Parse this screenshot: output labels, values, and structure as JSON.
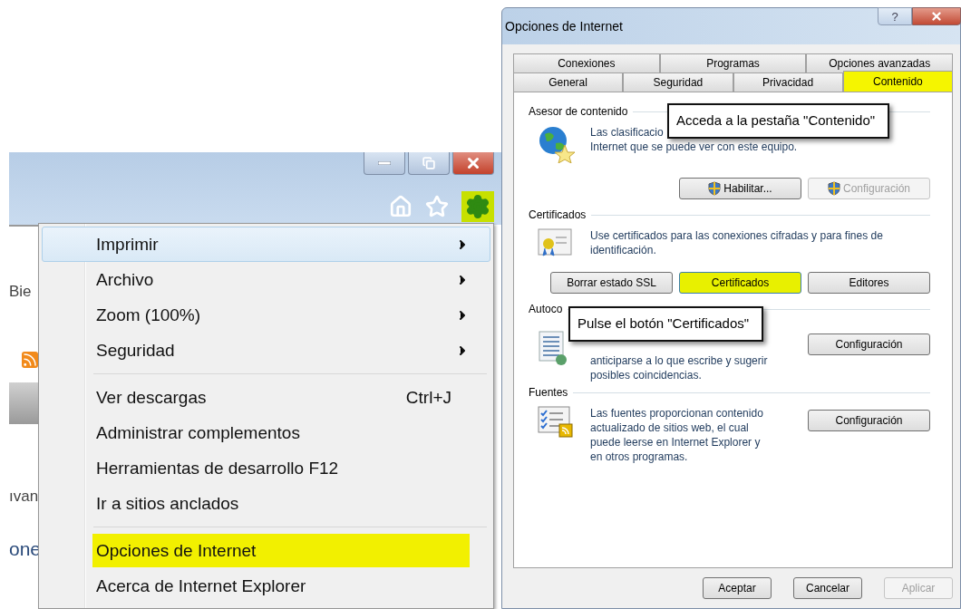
{
  "browser": {
    "page_fragments": [
      "Bie",
      "ıvan",
      "one"
    ],
    "gear_highlighted": true,
    "menu": {
      "items": [
        {
          "kind": "item",
          "label": "Imprimir",
          "submenu": true,
          "hovered": true,
          "highlighted": false
        },
        {
          "kind": "item",
          "label": "Archivo",
          "submenu": true,
          "hovered": false,
          "highlighted": false
        },
        {
          "kind": "item",
          "label": "Zoom (100%)",
          "submenu": true,
          "hovered": false,
          "highlighted": false
        },
        {
          "kind": "item",
          "label": "Seguridad",
          "submenu": true,
          "hovered": false,
          "highlighted": false
        },
        {
          "kind": "separator"
        },
        {
          "kind": "item",
          "label": "Ver descargas",
          "shortcut": "Ctrl+J",
          "submenu": false,
          "hovered": false,
          "highlighted": false
        },
        {
          "kind": "item",
          "label": "Administrar complementos",
          "submenu": false,
          "hovered": false,
          "highlighted": false
        },
        {
          "kind": "item",
          "label": "Herramientas de desarrollo F12",
          "submenu": false,
          "hovered": false,
          "highlighted": false
        },
        {
          "kind": "item",
          "label": "Ir a sitios anclados",
          "submenu": false,
          "hovered": false,
          "highlighted": false
        },
        {
          "kind": "separator"
        },
        {
          "kind": "item",
          "label": "Opciones de Internet",
          "submenu": false,
          "hovered": false,
          "highlighted": true
        },
        {
          "kind": "item",
          "label": "Acerca de Internet Explorer",
          "submenu": false,
          "hovered": false,
          "highlighted": false
        }
      ]
    }
  },
  "dialog": {
    "title": "Opciones de Internet",
    "help_label": "?",
    "tab_rows": [
      {
        "tabs": [
          {
            "label": "Conexiones",
            "selected": false,
            "highlighted": false
          },
          {
            "label": "Programas",
            "selected": false,
            "highlighted": false
          },
          {
            "label": "Opciones avanzadas",
            "selected": false,
            "highlighted": false
          }
        ]
      },
      {
        "tabs": [
          {
            "label": "General",
            "selected": false,
            "highlighted": false
          },
          {
            "label": "Seguridad",
            "selected": false,
            "highlighted": false
          },
          {
            "label": "Privacidad",
            "selected": false,
            "highlighted": false
          },
          {
            "label": "Contenido",
            "selected": true,
            "highlighted": true
          }
        ]
      }
    ],
    "sections": [
      {
        "title": "Asesor de contenido",
        "kind": "below",
        "lines": [
          "Las clasificacio",
          "Internet que se puede ver con este equipo."
        ],
        "buttons": [
          {
            "label": "Habilitar...",
            "kind": "uac",
            "disabled": false,
            "highlighted": false
          },
          {
            "label": "Configuración",
            "kind": "uac",
            "disabled": true,
            "highlighted": false
          }
        ]
      },
      {
        "title": "Certificados",
        "kind": "below",
        "lines": [
          "Use certificados para las conexiones cifradas y para fines de",
          "identificación."
        ],
        "buttons": [
          {
            "label": "Borrar estado SSL",
            "kind": "plain",
            "disabled": false,
            "highlighted": false
          },
          {
            "label": "Certificados",
            "kind": "plain",
            "disabled": false,
            "highlighted": true
          },
          {
            "label": "Editores",
            "kind": "plain",
            "disabled": false,
            "highlighted": false
          }
        ]
      },
      {
        "title": "Autoco",
        "kind": "side",
        "lines": [
          "anticiparse a lo que escribe y sugerir",
          "posibles coincidencias."
        ],
        "buttons": [
          {
            "label": "Configuración",
            "kind": "plain",
            "disabled": false,
            "highlighted": false
          }
        ]
      },
      {
        "title": "Fuentes",
        "kind": "side",
        "lines": [
          "Las fuentes proporcionan contenido",
          "actualizado de sitios web, el cual",
          "puede leerse en Internet Explorer y",
          "en otros programas."
        ],
        "buttons": [
          {
            "label": "Configuración",
            "kind": "plain",
            "disabled": false,
            "highlighted": false
          }
        ]
      }
    ],
    "footer_buttons": [
      {
        "label": "Aceptar",
        "disabled": false
      },
      {
        "label": "Cancelar",
        "disabled": false
      },
      {
        "label": "Aplicar",
        "disabled": true
      }
    ],
    "callouts": [
      "Acceda a la pestaña \"Contenido\"",
      "Pulse el botón \"Certificados\""
    ]
  }
}
